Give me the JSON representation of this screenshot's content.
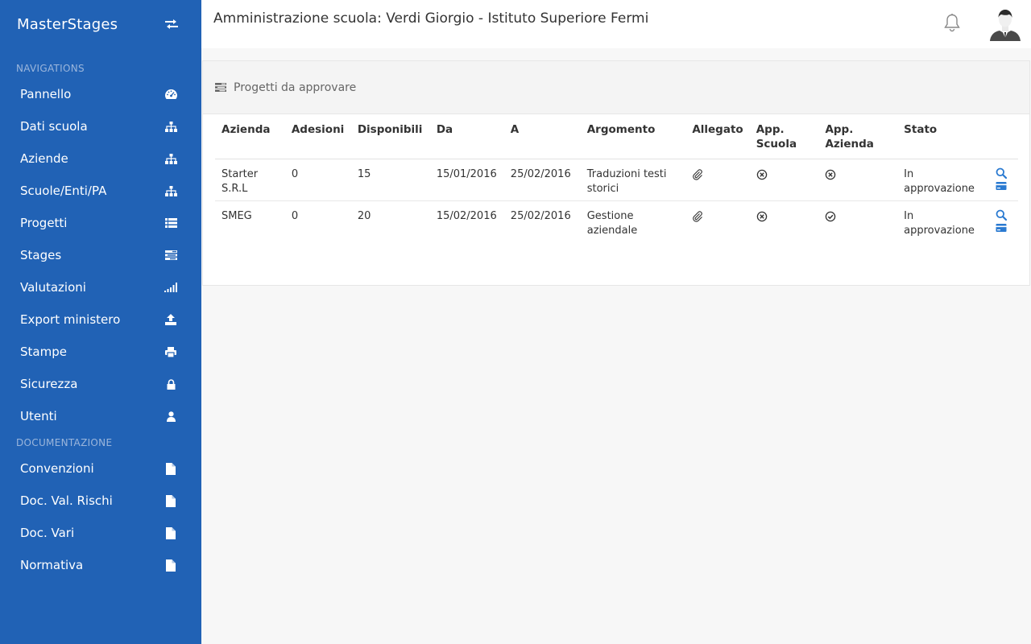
{
  "sidebar": {
    "brand": "MasterStages",
    "sections": [
      {
        "label": "NAVIGATIONS"
      },
      {
        "label": "DOCUMENTAZIONE"
      }
    ],
    "nav": [
      {
        "label": "Pannello",
        "icon": "dashboard-icon"
      },
      {
        "label": "Dati scuola",
        "icon": "sitemap-icon"
      },
      {
        "label": "Aziende",
        "icon": "sitemap-icon"
      },
      {
        "label": "Scuole/Enti/PA",
        "icon": "sitemap-icon"
      },
      {
        "label": "Progetti",
        "icon": "list-icon"
      },
      {
        "label": "Stages",
        "icon": "tasks-icon"
      },
      {
        "label": "Valutazioni",
        "icon": "signal-icon"
      },
      {
        "label": "Export ministero",
        "icon": "upload-icon"
      },
      {
        "label": "Stampe",
        "icon": "print-icon"
      },
      {
        "label": "Sicurezza",
        "icon": "lock-icon"
      },
      {
        "label": "Utenti",
        "icon": "user-icon"
      }
    ],
    "docs": [
      {
        "label": "Convenzioni",
        "icon": "file-icon"
      },
      {
        "label": "Doc. Val. Rischi",
        "icon": "file-icon"
      },
      {
        "label": "Doc. Vari",
        "icon": "file-icon"
      },
      {
        "label": "Normativa",
        "icon": "file-icon"
      }
    ]
  },
  "header": {
    "title": "Amministrazione scuola: Verdi Giorgio - Istituto Superiore Fermi"
  },
  "panel": {
    "heading": "Progetti da approvare",
    "columns": [
      "Azienda",
      "Adesioni",
      "Disponibili",
      "Da",
      "A",
      "Argomento",
      "Allegato",
      "App. Scuola",
      "App. Azienda",
      "Stato",
      ""
    ],
    "rows": [
      {
        "azienda": "Starter S.R.L",
        "adesioni": "0",
        "disponibili": "15",
        "da": "15/01/2016",
        "a": "25/02/2016",
        "argomento": "Traduzioni testi storici",
        "app_scuola": "rejected",
        "app_azienda": "rejected",
        "stato": "In approvazione"
      },
      {
        "azienda": "SMEG",
        "adesioni": "0",
        "disponibili": "20",
        "da": "15/02/2016",
        "a": "25/02/2016",
        "argomento": "Gestione aziendale",
        "app_scuola": "rejected",
        "app_azienda": "approved",
        "stato": "In approvazione"
      }
    ]
  },
  "colors": {
    "sidebar_bg": "#2162b5",
    "accent": "#2a7ad1",
    "section_label": "#9bb6dc"
  }
}
